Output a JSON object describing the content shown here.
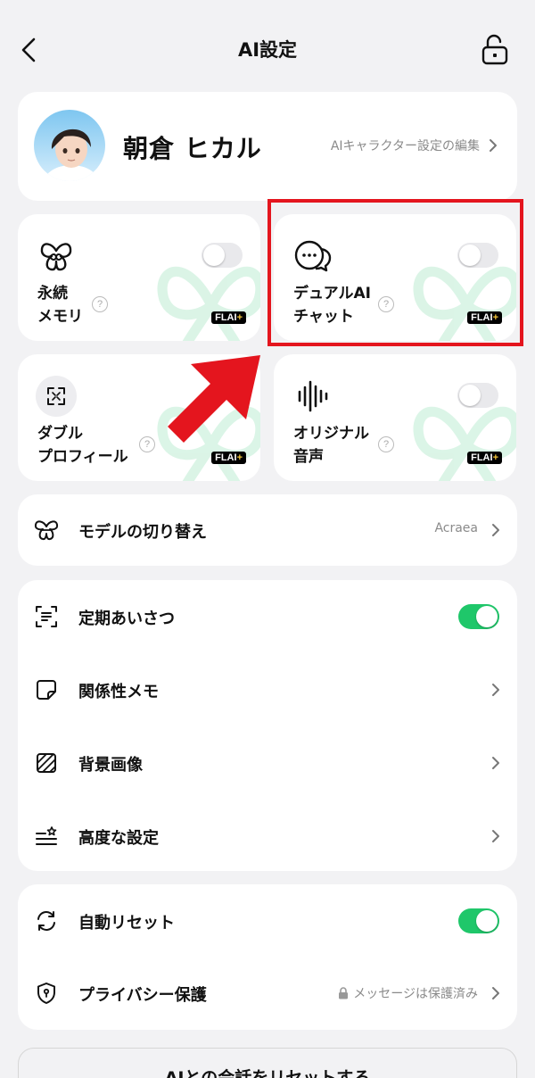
{
  "header": {
    "title": "AI設定"
  },
  "profile": {
    "name": "朝倉 ヒカル",
    "edit_label": "AIキャラクター設定の編集"
  },
  "tiles": [
    {
      "label": "永続\nメモリ",
      "badge": "FLAI",
      "badge_plus": "+",
      "toggle": "off"
    },
    {
      "label": "デュアルAI\nチャット",
      "badge": "FLAI",
      "badge_plus": "+",
      "toggle": "off"
    },
    {
      "label": "ダブル\nプロフィール",
      "badge": "FLAI",
      "badge_plus": "+"
    },
    {
      "label": "オリジナル\n音声",
      "badge": "FLAI",
      "badge_plus": "+",
      "toggle": "off"
    }
  ],
  "model_row": {
    "label": "モデルの切り替え",
    "value": "Acraea"
  },
  "settings": [
    {
      "label": "定期あいさつ",
      "toggle": "on"
    },
    {
      "label": "関係性メモ"
    },
    {
      "label": "背景画像"
    },
    {
      "label": "高度な設定"
    }
  ],
  "reset_group": [
    {
      "label": "自動リセット",
      "toggle": "on"
    },
    {
      "label": "プライバシー保護",
      "value": "メッセージは保護済み"
    }
  ],
  "reset_button": {
    "label": "AIとの会話をリセットする"
  },
  "colors": {
    "accent_green": "#1fc76a",
    "highlight_red": "#e4151e",
    "badge_plus": "#f5c83a"
  }
}
